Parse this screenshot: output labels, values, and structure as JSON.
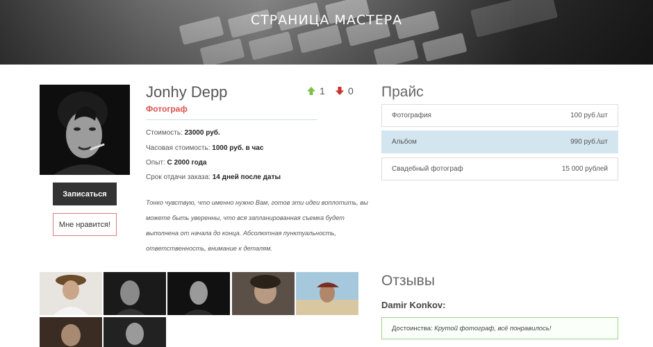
{
  "hero": {
    "title": "СТРАНИЦА МАСТЕРА"
  },
  "profile": {
    "name": "Jonhy Depp",
    "role": "Фотограф",
    "votes": {
      "up": "1",
      "down": "0"
    },
    "fields": [
      {
        "label": "Стоимость:",
        "value": "23000 руб."
      },
      {
        "label": "Часовая стоимость:",
        "value": "1000 руб. в час"
      },
      {
        "label": "Опыт:",
        "value": "С 2000 года"
      },
      {
        "label": "Срок отдачи заказа:",
        "value": "14 дней после даты"
      }
    ],
    "description": "Тонко чувствую, что именно нужно Вам, готов эти идеи воплотить, вы можете быть уверенны, что вся запланированная съемка будет выполнена от начала до конца. Абсолютная пунктуальность, ответственность, внимание к деталям.",
    "book_button": "Записаться",
    "like_button": "Мне нравится!"
  },
  "price": {
    "title": "Прайс",
    "items": [
      {
        "name": "Фотография",
        "value": "100 руб./шт",
        "active": false
      },
      {
        "name": "Альбом",
        "value": "990 руб./шт",
        "active": true
      },
      {
        "name": "Свадебный фотограф",
        "value": "15 000 рублей",
        "active": false
      }
    ]
  },
  "reviews": {
    "title": "Отзывы",
    "items": [
      {
        "author": "Damir Konkov:",
        "label": "Достоинства:",
        "text": "Крутой фотограф, всё понравилось!"
      }
    ]
  },
  "icons": {
    "up": "arrow-up-icon",
    "down": "arrow-down-icon"
  },
  "colors": {
    "accent_red": "#d9534f",
    "up_green": "#7cc04b",
    "down_red": "#c9302c",
    "active_row": "#d3e5ef"
  }
}
